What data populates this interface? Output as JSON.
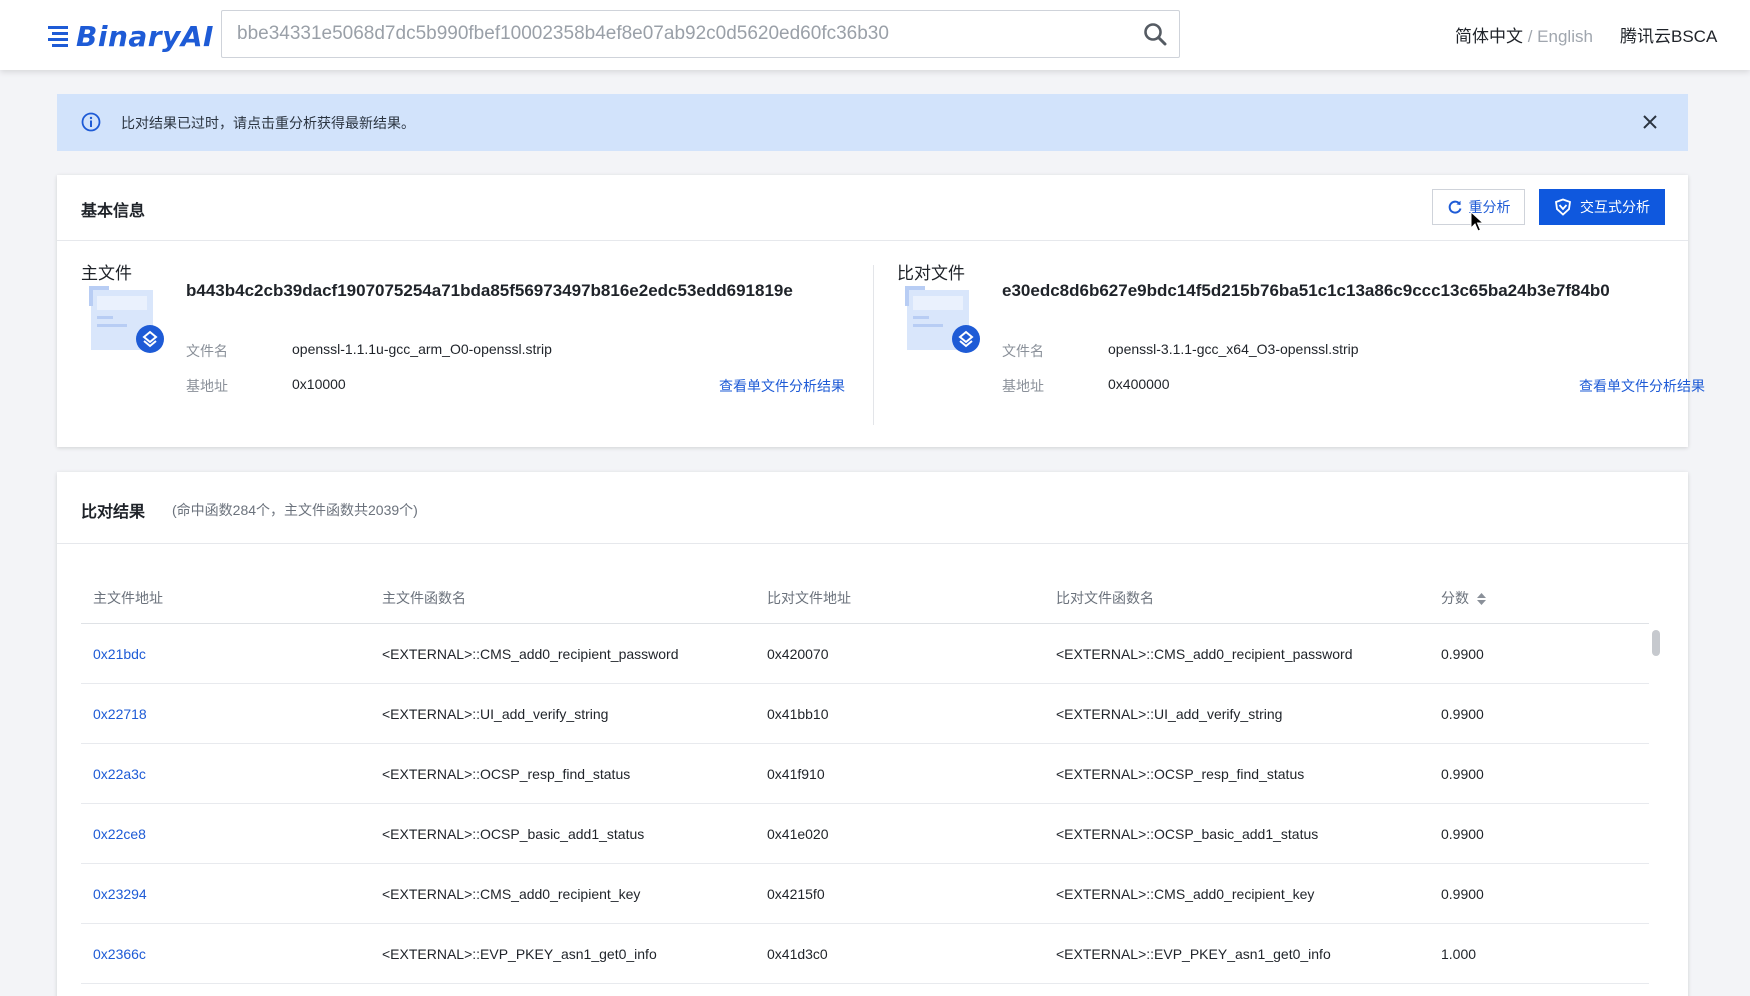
{
  "header": {
    "logo_text": "BinaryAI",
    "search_value": "bbe34331e5068d7dc5b990fbef10002358b4ef8e07ab92c0d5620ed60fc36b30",
    "lang_zh": "简体中文",
    "lang_sep": " / ",
    "lang_en": "English",
    "bsca_label": "腾讯云BSCA"
  },
  "alert": {
    "text": "比对结果已过时，请点击重分析获得最新结果。"
  },
  "basic_info": {
    "title": "基本信息",
    "reanalyze_label": "重分析",
    "interactive_label": "交互式分析",
    "main_file": {
      "label": "主文件",
      "hash": "b443b4c2cb39dacf1907075254a71bda85f56973497b816e2edc53edd691819e",
      "filename_key": "文件名",
      "filename": "openssl-1.1.1u-gcc_arm_O0-openssl.strip",
      "base_key": "基地址",
      "base": "0x10000",
      "view_link": "查看单文件分析结果"
    },
    "compare_file": {
      "label": "比对文件",
      "hash": "e30edc8d6b627e9bdc14f5d215b76ba51c1c13a86c9ccc13c65ba24b3e7f84b0",
      "filename_key": "文件名",
      "filename": "openssl-3.1.1-gcc_x64_O3-openssl.strip",
      "base_key": "基地址",
      "base": "0x400000",
      "view_link": "查看单文件分析结果"
    }
  },
  "results": {
    "title": "比对结果",
    "subtitle": "(命中函数284个，主文件函数共2039个)",
    "columns": [
      "主文件地址",
      "主文件函数名",
      "比对文件地址",
      "比对文件函数名",
      "分数"
    ],
    "rows": [
      [
        "0x21bdc",
        "<EXTERNAL>::CMS_add0_recipient_password",
        "0x420070",
        "<EXTERNAL>::CMS_add0_recipient_password",
        "0.9900"
      ],
      [
        "0x22718",
        "<EXTERNAL>::UI_add_verify_string",
        "0x41bb10",
        "<EXTERNAL>::UI_add_verify_string",
        "0.9900"
      ],
      [
        "0x22a3c",
        "<EXTERNAL>::OCSP_resp_find_status",
        "0x41f910",
        "<EXTERNAL>::OCSP_resp_find_status",
        "0.9900"
      ],
      [
        "0x22ce8",
        "<EXTERNAL>::OCSP_basic_add1_status",
        "0x41e020",
        "<EXTERNAL>::OCSP_basic_add1_status",
        "0.9900"
      ],
      [
        "0x23294",
        "<EXTERNAL>::CMS_add0_recipient_key",
        "0x4215f0",
        "<EXTERNAL>::CMS_add0_recipient_key",
        "0.9900"
      ],
      [
        "0x2366c",
        "<EXTERNAL>::EVP_PKEY_asn1_get0_info",
        "0x41d3c0",
        "<EXTERNAL>::EVP_PKEY_asn1_get0_info",
        "1.000"
      ]
    ]
  },
  "colors": {
    "accent": "#1e5bd6",
    "primary_button": "#0f58de",
    "alert_bg": "#d2e3fb"
  }
}
